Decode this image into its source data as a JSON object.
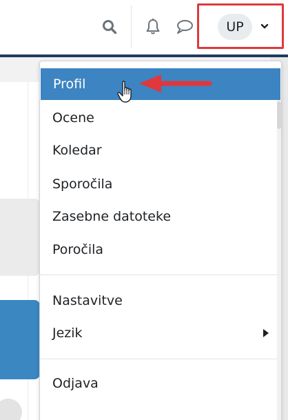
{
  "header": {
    "search_icon": "search-icon",
    "notifications_icon": "bell-icon",
    "messages_icon": "chat-icon",
    "user_initials": "UP",
    "user_menu_caret": "chevron-down-icon"
  },
  "dropdown": {
    "items": [
      {
        "label": "Profil",
        "active": true
      },
      {
        "label": "Ocene"
      },
      {
        "label": "Koledar"
      },
      {
        "label": "Sporočila"
      },
      {
        "label": "Zasebne datoteke"
      },
      {
        "label": "Poročila"
      },
      {
        "label": "Nastavitve"
      },
      {
        "label": "Jezik",
        "has_submenu": true
      },
      {
        "label": "Odjava"
      }
    ]
  },
  "colors": {
    "navbar_border": "#223a5e",
    "highlight": "#e0383c",
    "active_item": "#3d84c2"
  }
}
